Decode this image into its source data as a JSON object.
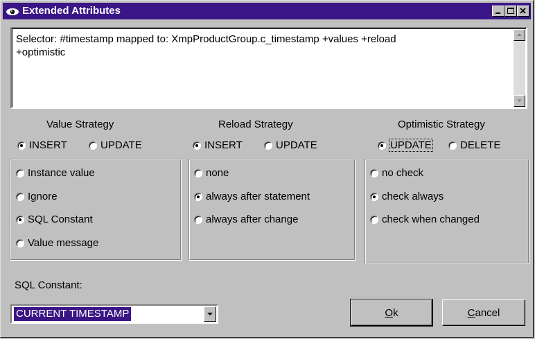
{
  "window": {
    "title": "Extended Attributes",
    "icon": "eye-icon",
    "controls": [
      "minimize-icon",
      "maximize-icon",
      "close-icon"
    ]
  },
  "selector": {
    "line1": "Selector: #timestamp mapped to: XmpProductGroup.c_timestamp +values +reload",
    "line2": "+optimistic"
  },
  "value_strategy": {
    "heading": "Value Strategy",
    "modes": [
      {
        "label": "INSERT",
        "selected": true
      },
      {
        "label": "UPDATE",
        "selected": false
      }
    ],
    "options": [
      {
        "label": "Instance value",
        "selected": false
      },
      {
        "label": "Ignore",
        "selected": false
      },
      {
        "label": "SQL Constant",
        "selected": true
      },
      {
        "label": "Value message",
        "selected": false
      }
    ]
  },
  "reload_strategy": {
    "heading": "Reload Strategy",
    "modes": [
      {
        "label": "INSERT",
        "selected": true
      },
      {
        "label": "UPDATE",
        "selected": false
      }
    ],
    "options": [
      {
        "label": "none",
        "selected": false
      },
      {
        "label": "always after statement",
        "selected": true
      },
      {
        "label": "always after change",
        "selected": false
      }
    ]
  },
  "optimistic_strategy": {
    "heading": "Optimistic Strategy",
    "modes": [
      {
        "label": "UPDATE",
        "selected": true
      },
      {
        "label": "DELETE",
        "selected": false
      }
    ],
    "options": [
      {
        "label": "no check",
        "selected": false
      },
      {
        "label": "check always",
        "selected": true
      },
      {
        "label": "check when changed",
        "selected": false
      }
    ]
  },
  "sql_constant": {
    "label": "SQL Constant:",
    "value": "CURRENT TIMESTAMP"
  },
  "buttons": {
    "ok_mnemonic": "O",
    "ok_rest": "k",
    "cancel_mnemonic": "C",
    "cancel_rest": "ancel"
  },
  "colors": {
    "titlebar": "#3a1586",
    "face": "#c0c0c0",
    "selection": "#3a1586"
  }
}
